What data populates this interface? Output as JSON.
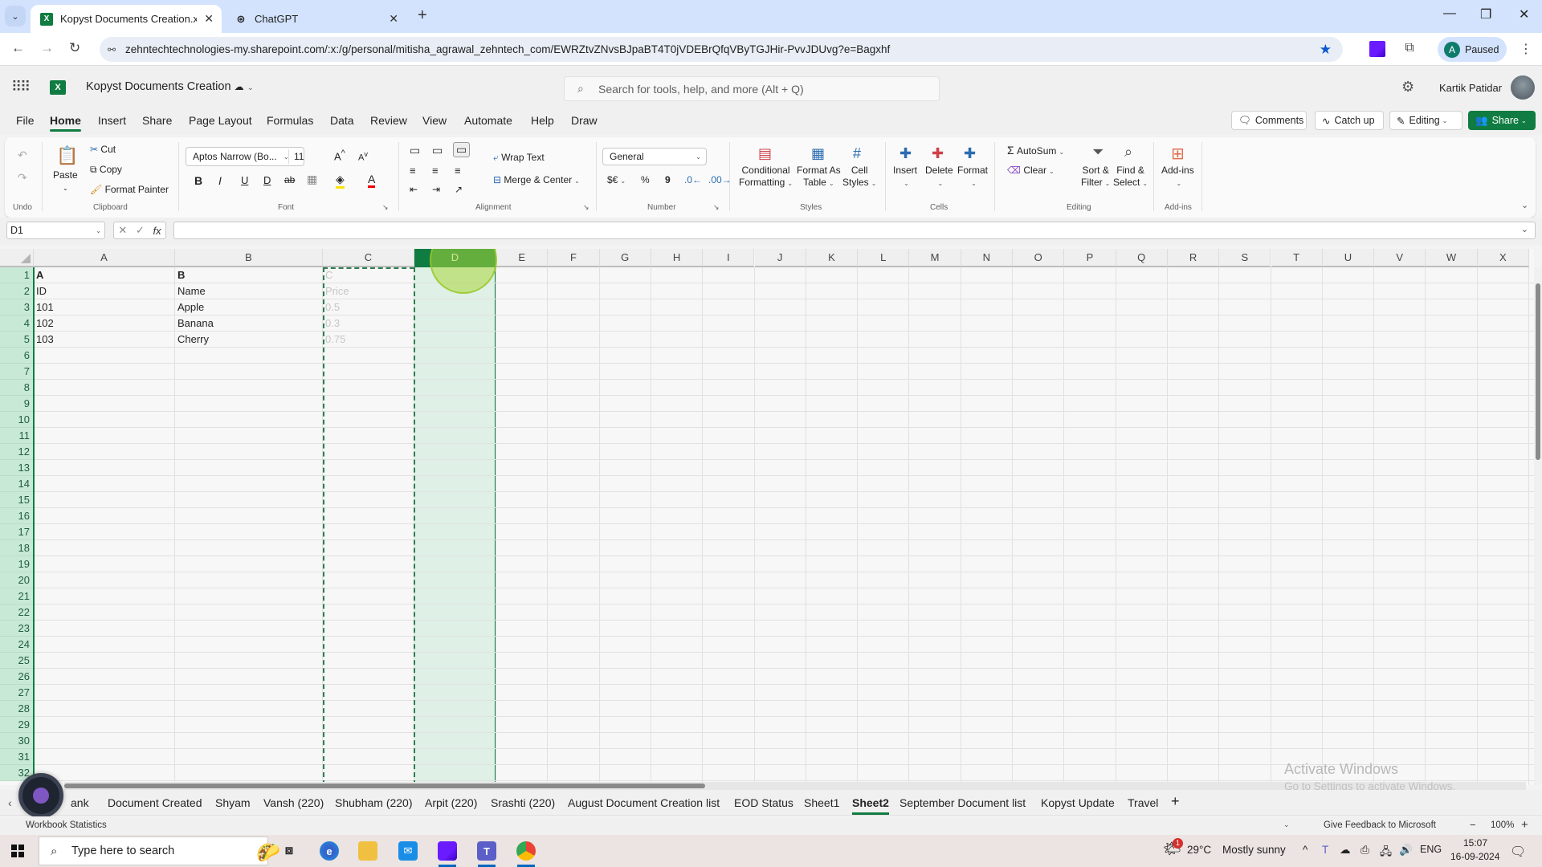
{
  "browser": {
    "tabs": [
      {
        "title": "Kopyst Documents Creation.xlsx",
        "icon": "excel-icon",
        "active": true
      },
      {
        "title": "ChatGPT",
        "icon": "chatgpt-icon",
        "active": false
      }
    ],
    "new_tab": "+",
    "url": "zehntechtechnologies-my.sharepoint.com/:x:/g/personal/mitisha_agrawal_zehntech_com/EWRZtvZNvsBJpaBT4T0jVDEBrQfqVByTGJHir-PvvJDUvg?e=Bagxhf",
    "profile_initial": "A",
    "profile_status": "Paused"
  },
  "app": {
    "doc_title": "Kopyst Documents Creation",
    "search_placeholder": "Search for tools, help, and more (Alt + Q)",
    "user_name": "Kartik Patidar",
    "menu_tabs": [
      "File",
      "Home",
      "Insert",
      "Share",
      "Page Layout",
      "Formulas",
      "Data",
      "Review",
      "View",
      "Automate",
      "Help",
      "Draw"
    ],
    "active_menu_tab": "Home",
    "header_buttons": {
      "comments": "Comments",
      "catchup": "Catch up",
      "editing": "Editing",
      "share": "Share"
    }
  },
  "ribbon": {
    "undo_group": "Undo",
    "clipboard": {
      "paste": "Paste",
      "cut": "Cut",
      "copy": "Copy",
      "format_painter": "Format Painter",
      "label": "Clipboard"
    },
    "font": {
      "name": "Aptos Narrow (Bo...",
      "size": "11",
      "label": "Font",
      "bold": "B",
      "italic": "I",
      "underline": "U",
      "double_underline": "D",
      "strike": "ab"
    },
    "alignment": {
      "wrap_text": "Wrap Text",
      "merge_center": "Merge & Center",
      "label": "Alignment"
    },
    "number": {
      "format": "General",
      "currency": "$€",
      "percent": "%",
      "comma": "9",
      "label": "Number"
    },
    "styles": {
      "conditional": [
        "Conditional",
        "Formatting"
      ],
      "format_table": [
        "Format As",
        "Table"
      ],
      "cell_styles": [
        "Cell",
        "Styles"
      ],
      "label": "Styles"
    },
    "cells": {
      "insert": "Insert",
      "delete": "Delete",
      "format": "Format",
      "label": "Cells"
    },
    "editing": {
      "autosum": "AutoSum",
      "clear": "Clear",
      "sort_filter": [
        "Sort &",
        "Filter"
      ],
      "find_select": [
        "Find &",
        "Select"
      ],
      "label": "Editing"
    },
    "addins": {
      "addins": "Add-ins",
      "label": "Add-ins"
    }
  },
  "formula_bar": {
    "name_box": "D1",
    "formula": ""
  },
  "grid": {
    "columns": [
      "A",
      "B",
      "C",
      "D",
      "E",
      "F",
      "G",
      "H",
      "I",
      "J",
      "K",
      "L",
      "M",
      "N",
      "O",
      "P",
      "Q",
      "R",
      "S",
      "T",
      "U",
      "V",
      "W",
      "X"
    ],
    "selected_column": "D",
    "row_count": 32,
    "cells": [
      {
        "ref": "A1",
        "value": "A",
        "bold": true
      },
      {
        "ref": "B1",
        "value": "B",
        "bold": true
      },
      {
        "ref": "C1",
        "value": "C",
        "faded": true
      },
      {
        "ref": "A2",
        "value": "ID"
      },
      {
        "ref": "B2",
        "value": "Name"
      },
      {
        "ref": "C2",
        "value": "Price",
        "faded": true
      },
      {
        "ref": "A3",
        "value": "101"
      },
      {
        "ref": "B3",
        "value": "Apple"
      },
      {
        "ref": "C3",
        "value": "0.5",
        "faded": true
      },
      {
        "ref": "A4",
        "value": "102"
      },
      {
        "ref": "B4",
        "value": "Banana"
      },
      {
        "ref": "C4",
        "value": "0.3",
        "faded": true
      },
      {
        "ref": "A5",
        "value": "103"
      },
      {
        "ref": "B5",
        "value": "Cherry"
      },
      {
        "ref": "C5",
        "value": "0.75",
        "faded": true
      }
    ]
  },
  "watermark": {
    "line1": "Activate Windows",
    "line2": "Go to Settings to activate Windows."
  },
  "sheet_tabs": {
    "tabs": [
      "ank",
      "Document Created",
      "Shyam",
      "Vansh (220)",
      "Shubham (220)",
      "Arpit (220)",
      "Srashti (220)",
      "August Document Creation list",
      "EOD Status",
      "Sheet1",
      "Sheet2",
      "September Document list",
      "Kopyst Update",
      "Travel"
    ],
    "active": "Sheet2",
    "add": "+"
  },
  "status_bar": {
    "left": "Workbook Statistics",
    "feedback": "Give Feedback to Microsoft",
    "zoom": "100%",
    "zoom_out": "−",
    "zoom_in": "+"
  },
  "taskbar": {
    "search_placeholder": "Type here to search",
    "weather_temp": "29°C",
    "weather_desc": "Mostly sunny",
    "weather_badge": "1",
    "language": "ENG",
    "time": "15:07",
    "date": "16-09-2024"
  },
  "colors": {
    "excel_green": "#107c41",
    "selection_fill": "#dff0e6",
    "row_header_selected": "#c9e9d7"
  }
}
